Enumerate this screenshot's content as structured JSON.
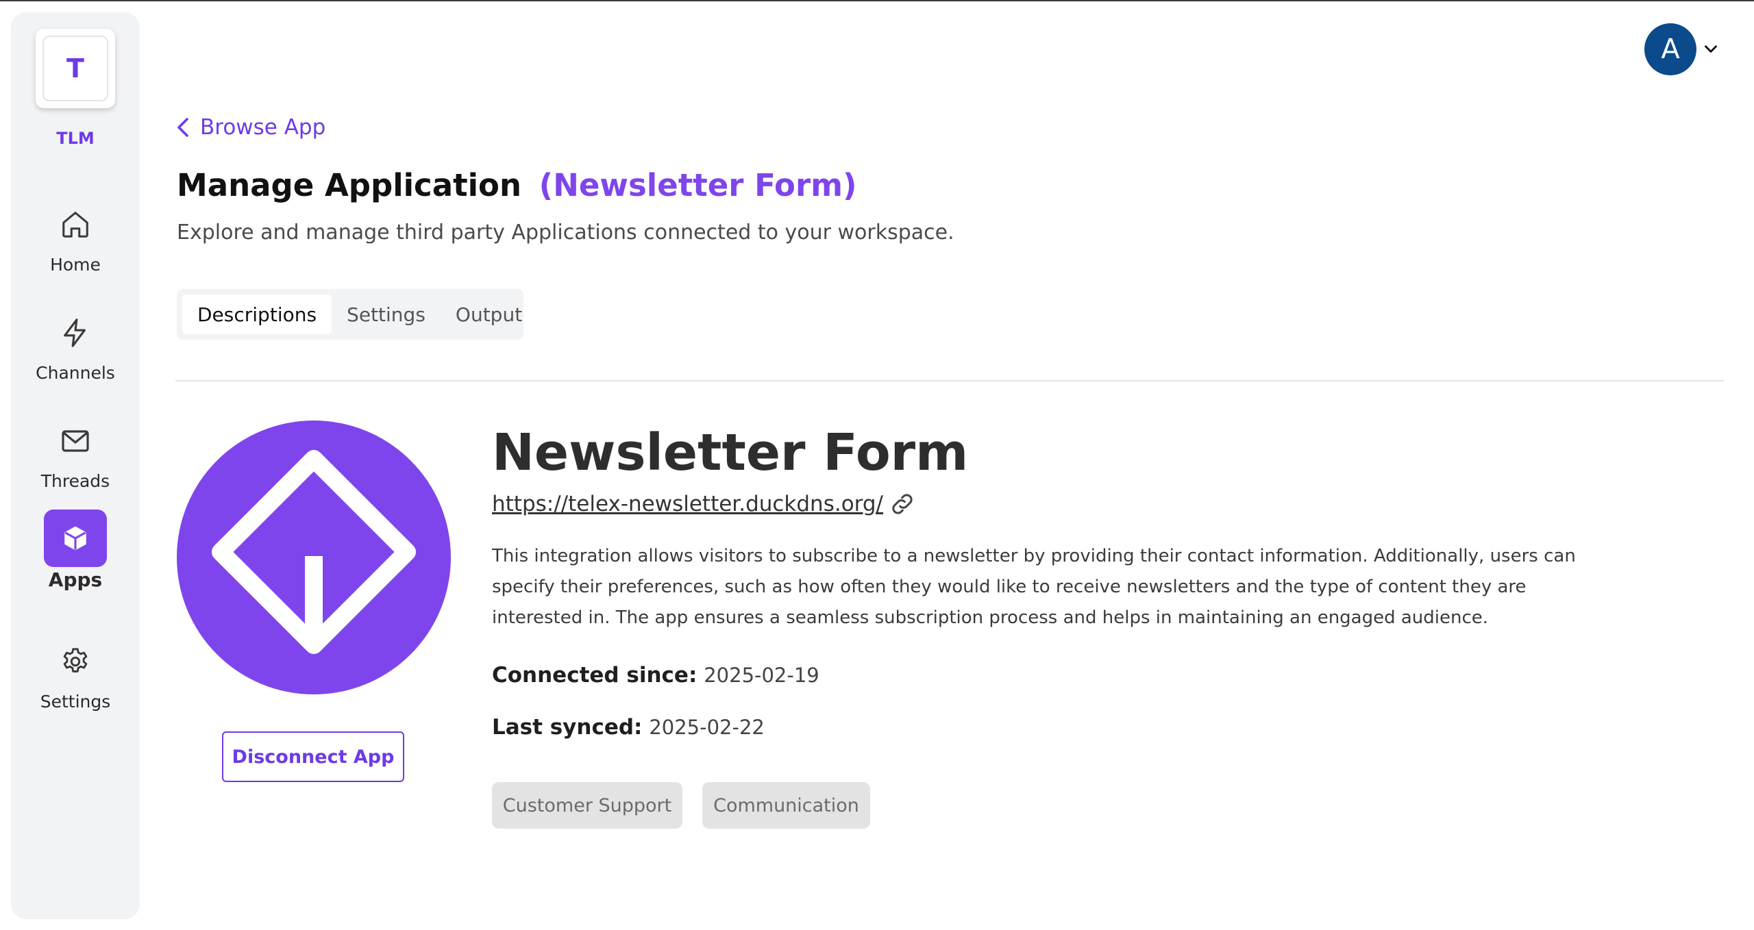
{
  "workspace": {
    "initial": "T",
    "name": "TLM"
  },
  "nav": {
    "home": "Home",
    "channels": "Channels",
    "threads": "Threads",
    "apps": "Apps",
    "settings": "Settings"
  },
  "user": {
    "avatar_initial": "A"
  },
  "header": {
    "back_label": "Browse App",
    "title": "Manage Application",
    "app_name": "(Newsletter Form)",
    "subtitle": "Explore and manage third party Applications connected to your workspace."
  },
  "tabs": [
    "Descriptions",
    "Settings",
    "Output"
  ],
  "active_tab": "Descriptions",
  "app": {
    "name": "Newsletter Form",
    "url": "https://telex-newsletter.duckdns.org/",
    "description": "This integration allows visitors to subscribe to a newsletter by providing their contact information. Additionally, users can specify their preferences, such as how often they would like to receive newsletters and the type of content they are interested in. The app ensures a seamless subscription process and helps in maintaining an engaged audience.",
    "connected_since_label": "Connected since:",
    "connected_since": "2025-02-19",
    "last_synced_label": "Last synced:",
    "last_synced": "2025-02-22",
    "tags": [
      "Customer Support",
      "Communication"
    ],
    "disconnect_label": "Disconnect App",
    "logo_icon": "diamond-download-icon"
  },
  "colors": {
    "accent": "#7f45ec",
    "avatar": "#0b4a8b",
    "sidebar_bg": "#f2f3f5",
    "tag_bg": "#e3e3e3"
  }
}
